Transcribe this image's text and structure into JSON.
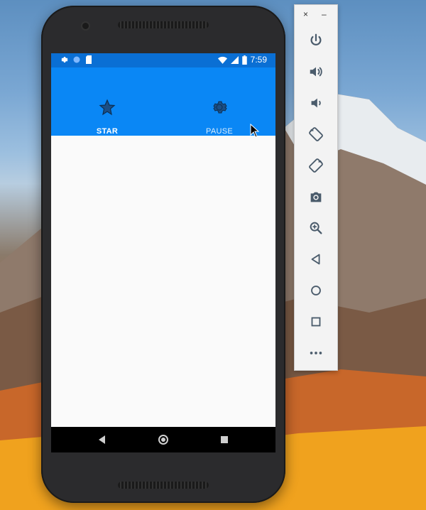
{
  "statusbar": {
    "time": "7:59",
    "icons_left": [
      "settings-icon",
      "sync-icon",
      "sd-card-icon"
    ],
    "icons_right": [
      "wifi-icon",
      "signal-icon",
      "battery-icon"
    ]
  },
  "tabs": [
    {
      "label": "STAR",
      "icon": "star-icon",
      "active": true
    },
    {
      "label": "PAUSE",
      "icon": "gear-icon",
      "active": false
    }
  ],
  "navbar": {
    "buttons": [
      "back-icon",
      "home-icon",
      "recents-icon"
    ]
  },
  "emulator_toolbar": {
    "window_controls": {
      "close": "×",
      "minimize": "–"
    },
    "buttons": [
      "power-icon",
      "volume-up-icon",
      "volume-down-icon",
      "rotate-left-icon",
      "rotate-right-icon",
      "camera-icon",
      "zoom-icon",
      "back-icon",
      "home-icon",
      "overview-icon",
      "more-icon"
    ]
  },
  "colors": {
    "statusbar": "#0a6fd4",
    "tabbar": "#0a87f5",
    "screen_bg": "#fafafa"
  }
}
